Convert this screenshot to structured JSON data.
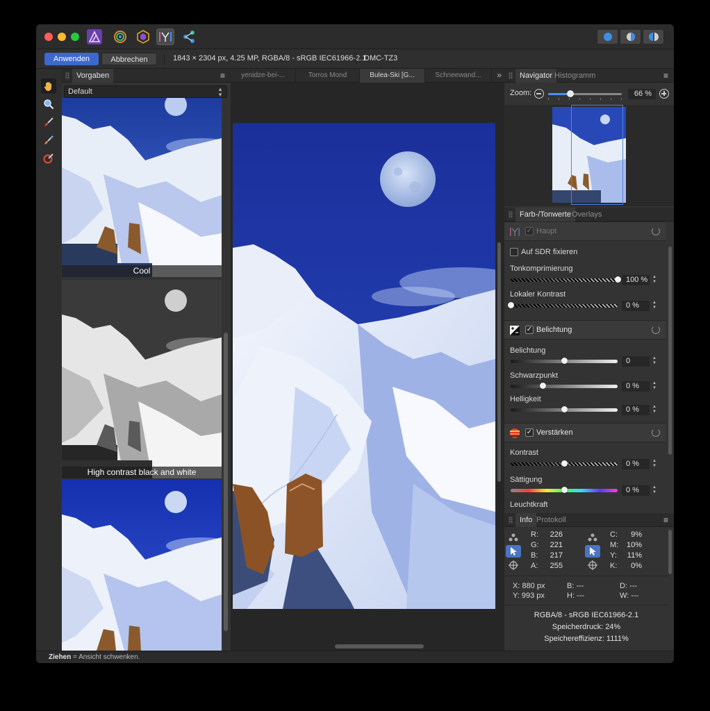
{
  "context_bar": {
    "apply_label": "Anwenden",
    "cancel_label": "Abbrechen",
    "image_info": "1843 × 2304 px, 4.25 MP, RGBA/8 - sRGB IEC61966-2.1",
    "camera": "DMC-TZ3"
  },
  "presets_panel": {
    "tab": "Vorgaben",
    "category": "Default",
    "presets": [
      {
        "label": "Cool"
      },
      {
        "label": "High contrast black and white"
      },
      {
        "label": ""
      }
    ]
  },
  "document_tabs": [
    "yenidze-bei-...",
    "Torros Mond",
    "Bulea-Ski [G...",
    "Schneewand..."
  ],
  "active_document_tab": 2,
  "navigator": {
    "tabs": [
      "Navigator",
      "Histogramm"
    ],
    "zoom_label": "Zoom:",
    "zoom_value": "66 %",
    "zoom_level": 0.3
  },
  "tone_panel": {
    "tabs": [
      "Farb-/Tonwerte",
      "Overlays"
    ],
    "main_group": {
      "title": "Haupt",
      "checked": true,
      "enabled": false
    },
    "sdr_label": "Auf SDR fixieren",
    "tone_compression": {
      "label": "Tonkomprimierung",
      "value": "100 %",
      "level": 1.0
    },
    "local_contrast": {
      "label": "Lokaler Kontrast",
      "value": "0 %",
      "level": 0.0
    },
    "exposure_group": {
      "title": "Belichtung",
      "checked": true
    },
    "exposure": {
      "label": "Belichtung",
      "value": "0",
      "level": 0.5
    },
    "black_point": {
      "label": "Schwarzpunkt",
      "value": "0 %",
      "level": 0.3
    },
    "brightness": {
      "label": "Helligkeit",
      "value": "0 %",
      "level": 0.5
    },
    "enhance_group": {
      "title": "Verstärken",
      "checked": true
    },
    "contrast": {
      "label": "Kontrast",
      "value": "0 %",
      "level": 0.5
    },
    "saturation": {
      "label": "Sättigung",
      "value": "0 %",
      "level": 0.5
    },
    "luminance": {
      "label": "Leuchtkraft"
    }
  },
  "info_panel": {
    "tabs": [
      "Info",
      "Protokoll"
    ],
    "rgb": {
      "r_label": "R:",
      "r": "226",
      "g_label": "G:",
      "g": "221",
      "b_label": "B:",
      "b": "217",
      "a_label": "A:",
      "a": "255"
    },
    "cmyk": {
      "c_label": "C:",
      "c": "9%",
      "m_label": "M:",
      "m": "10%",
      "y_label": "Y:",
      "y": "11%",
      "k_label": "K:",
      "k": "0%"
    },
    "coords": {
      "x": "X: 880 px",
      "y": "Y: 993 px",
      "b": "B: ---",
      "h": "H: ---",
      "d": "D: ---",
      "w": "W: ---"
    },
    "color_profile": "RGBA/8 - sRGB IEC61966-2.1",
    "memory_pressure": "Speicherdruck: 24%",
    "memory_efficiency": "Speichereffizienz: 1111%"
  },
  "status_bar": {
    "bold": "Ziehen",
    "text": " = Ansicht schwenken."
  },
  "colors": {
    "accent": "#3d68cf",
    "sky": "#1f3aa8"
  }
}
